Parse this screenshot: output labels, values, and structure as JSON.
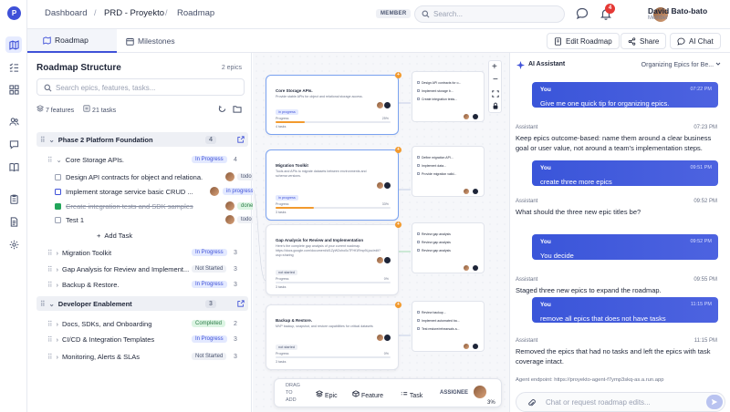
{
  "breadcrumb": {
    "root": "Dashboard",
    "project": "PRD - Proyekto",
    "page": "Roadmap"
  },
  "role_badge": "MEMBER",
  "search": {
    "placeholder": "Search..."
  },
  "notifications": {
    "count": "4"
  },
  "user": {
    "name": "David Bato-bato",
    "role": "Member"
  },
  "tabs": [
    {
      "label": "Roadmap"
    },
    {
      "label": "Milestones"
    }
  ],
  "header_actions": {
    "edit": "Edit Roadmap",
    "share": "Share",
    "ai_chat": "AI Chat"
  },
  "structure": {
    "title": "Roadmap Structure",
    "epic_count": "2 epics",
    "search_placeholder": "Search epics, features, tasks...",
    "features_count": "7 features",
    "tasks_count": "21 tasks",
    "rows": [
      {
        "kind": "phase",
        "label": "Phase 2 Platform Foundation",
        "count": "4"
      },
      {
        "kind": "epic",
        "label": "Core Storage APIs.",
        "status": "In Progress",
        "count": "4"
      },
      {
        "kind": "task",
        "label": "Design API contracts for object and relationa...",
        "status": "todo"
      },
      {
        "kind": "task",
        "label": "Implement storage service basic CRUD ...",
        "status": "in progress"
      },
      {
        "kind": "task",
        "label": "Create integration tests and SDK samples",
        "status": "done"
      },
      {
        "kind": "task",
        "label": "Test 1",
        "status": "todo"
      },
      {
        "kind": "add",
        "label": "Add Task"
      },
      {
        "kind": "epic",
        "label": "Migration Toolkit",
        "status": "In Progress",
        "count": "3"
      },
      {
        "kind": "epic",
        "label": "Gap Analysis for Review and Implement...",
        "status": "Not Started",
        "count": "3"
      },
      {
        "kind": "epic",
        "label": "Backup & Restore.",
        "status": "In Progress",
        "count": "3"
      },
      {
        "kind": "phase",
        "label": "Developer Enablement",
        "count": "3"
      },
      {
        "kind": "epic",
        "label": "Docs, SDKs, and Onboarding",
        "status": "Completed",
        "count": "2"
      },
      {
        "kind": "epic",
        "label": "CI/CD & Integration Templates",
        "status": "In Progress",
        "count": "3"
      },
      {
        "kind": "epic",
        "label": "Monitoring, Alerts & SLAs",
        "status": "Not Started",
        "count": "3"
      }
    ]
  },
  "canvas": {
    "cards": [
      {
        "title": "Core Storage APIs.",
        "desc": "Provide stable APIs for object and relational storage access.",
        "status": "in progress",
        "progress_label": "Progress",
        "progress_pct": "25%",
        "progress": 0.25,
        "tasks": "4 tasks"
      },
      {
        "title": "Migration Toolkit",
        "desc": "Tools and APIs to migrate datasets between environments and schema versions.",
        "status": "in progress",
        "progress_label": "Progress",
        "progress_pct": "33%",
        "progress": 0.33,
        "tasks": "3 tasks"
      },
      {
        "title": "Gap Analysis for Review and Implementation",
        "desc": "Here's the complete gap analysis of your current roadmap. https://docs.google.com/document/d/1ZyW2oho0uTFHf1Rmp9Ljcu/edit?usp=sharing",
        "status": "not started",
        "progress_label": "Progress",
        "progress_pct": "0%",
        "progress": 0.0,
        "tasks": "3 tasks"
      },
      {
        "title": "Backup & Restore.",
        "desc": "MVP backup, snapshot, and restore capabilities for critical datasets",
        "status": "not started",
        "progress_label": "Progress",
        "progress_pct": "0%",
        "progress": 0.0,
        "tasks": "3 tasks"
      }
    ],
    "task_lists": [
      [
        "Design API contracts for o...",
        "Implement storage b...",
        "Create integration tests..."
      ],
      [
        "Define migration API...",
        "Implement data...",
        "Provide migration valid..."
      ],
      [
        "Review gap analysis",
        "Review gap analysis",
        "Review gap analysis"
      ],
      [
        "Review backup...",
        "Implement automated ba...",
        "Test restore/rehearsals a..."
      ]
    ],
    "toolbar": {
      "drag": "DRAG TO ADD",
      "epic": "Epic",
      "feature": "Feature",
      "task": "Task",
      "assignee": "ASSIGNEE",
      "pct": "3%"
    }
  },
  "ai": {
    "title": "AI Assistant",
    "context": "Organizing Epics for Be...",
    "messages": [
      {
        "role": "user",
        "who": "You",
        "time": "07:22 PM",
        "text": "Give me one quick tip for organizing epics."
      },
      {
        "role": "assistant",
        "who": "Assistant",
        "time": "07:23 PM",
        "text": "Keep epics outcome-based: name them around a clear business goal or user value, not around a team's implementation steps."
      },
      {
        "role": "user",
        "who": "You",
        "time": "09:51 PM",
        "text": "create three more epics"
      },
      {
        "role": "assistant",
        "who": "Assistant",
        "time": "09:52 PM",
        "text": "What should the three new epic titles be?"
      },
      {
        "role": "user",
        "who": "You",
        "time": "09:52 PM",
        "text": "You decide"
      },
      {
        "role": "assistant",
        "who": "Assistant",
        "time": "09:55 PM",
        "text": "Staged three new epics to expand the roadmap."
      },
      {
        "role": "user",
        "who": "You",
        "time": "11:15 PM",
        "text": "remove all epics that does not have tasks"
      },
      {
        "role": "assistant",
        "who": "Assistant",
        "time": "11:15 PM",
        "text": "Removed the epics that had no tasks and left the epics with task coverage intact."
      }
    ],
    "endpoint": "Agent endpoint: https://proyekto-agent-f7ymp3skq-as.a.run.app",
    "input_placeholder": "Chat or request roadmap edits..."
  },
  "colors": {
    "accent": "#3f51d8",
    "progress": "#f29a2e",
    "success": "#22a55a"
  }
}
